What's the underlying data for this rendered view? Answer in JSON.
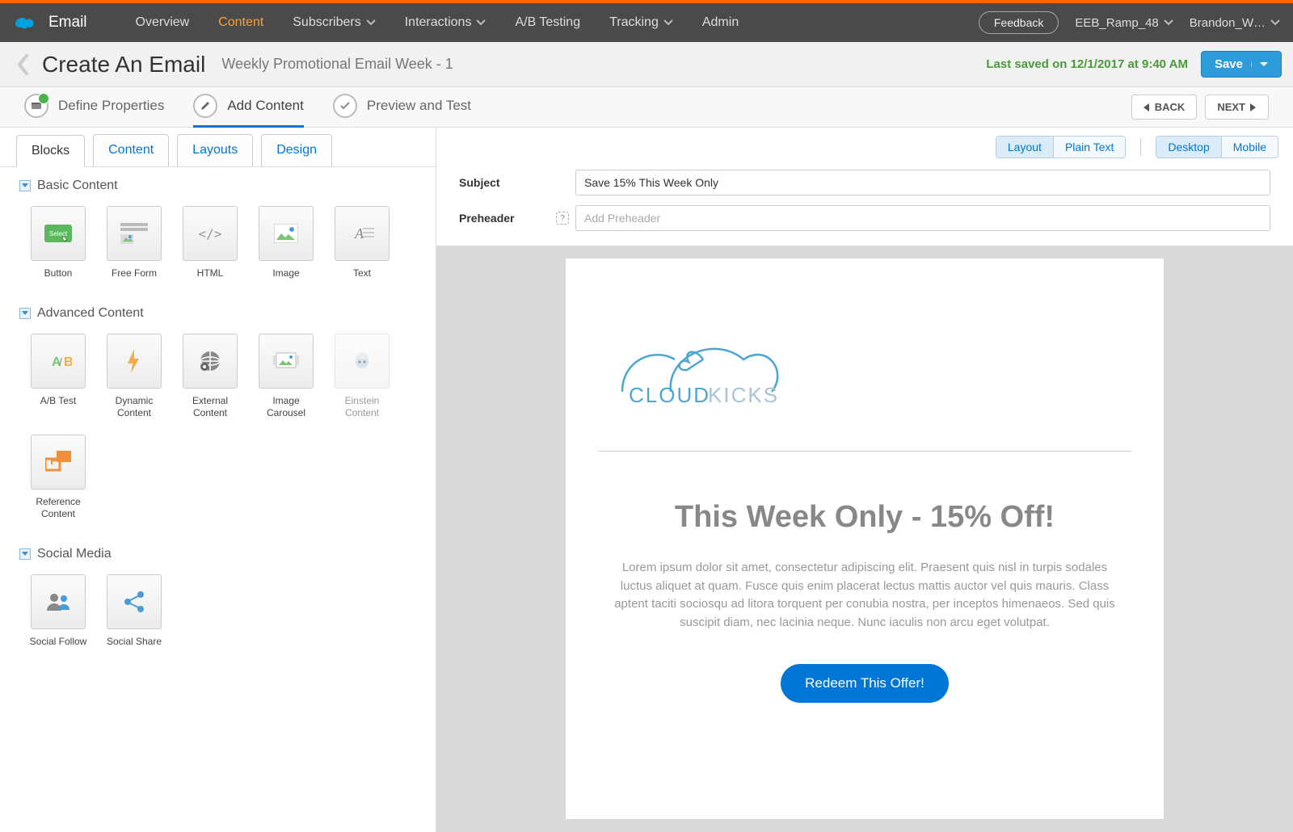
{
  "topnav": {
    "app": "Email",
    "items": [
      "Overview",
      "Content",
      "Subscribers",
      "Interactions",
      "A/B Testing",
      "Tracking",
      "Admin"
    ],
    "active_index": 1,
    "has_dropdown": [
      false,
      false,
      true,
      true,
      false,
      true,
      false
    ],
    "feedback": "Feedback",
    "org": "EEB_Ramp_48",
    "user": "Brandon_W…"
  },
  "subheader": {
    "title": "Create An Email",
    "subtitle": "Weekly Promotional Email Week - 1",
    "saved": "Last saved on 12/1/2017 at 9:40 AM",
    "save": "Save"
  },
  "steps": {
    "items": [
      "Define Properties",
      "Add Content",
      "Preview and Test"
    ],
    "active_index": 1,
    "back": "BACK",
    "next": "NEXT"
  },
  "left": {
    "tabs": [
      "Blocks",
      "Content",
      "Layouts",
      "Design"
    ],
    "active_tab": 0,
    "sections": {
      "basic": {
        "title": "Basic Content",
        "blocks": [
          "Button",
          "Free Form",
          "HTML",
          "Image",
          "Text"
        ]
      },
      "advanced": {
        "title": "Advanced Content",
        "blocks": [
          "A/B Test",
          "Dynamic Content",
          "External Content",
          "Image Carousel",
          "Einstein Content",
          "Reference Content"
        ]
      },
      "social": {
        "title": "Social Media",
        "blocks": [
          "Social Follow",
          "Social Share"
        ]
      }
    }
  },
  "right": {
    "view_toggle": {
      "layout": "Layout",
      "plaintext": "Plain Text"
    },
    "device_toggle": {
      "desktop": "Desktop",
      "mobile": "Mobile"
    },
    "subject_label": "Subject",
    "subject_value": "Save 15% This Week Only",
    "preheader_label": "Preheader",
    "preheader_placeholder": "Add Preheader"
  },
  "email": {
    "logo_cloud": "CLOUD",
    "logo_kicks": "KICKS",
    "headline": "This Week Only - 15% Off!",
    "body": "Lorem ipsum dolor sit amet, consectetur adipiscing elit. Praesent quis nisl in turpis sodales luctus aliquet at quam. Fusce quis enim placerat lectus mattis auctor vel quis mauris. Class aptent taciti sociosqu ad litora torquent per conubia nostra, per inceptos himenaeos. Sed quis suscipit diam, nec lacinia neque. Nunc iaculis non arcu eget volutpat.",
    "cta": "Redeem This Offer!"
  }
}
